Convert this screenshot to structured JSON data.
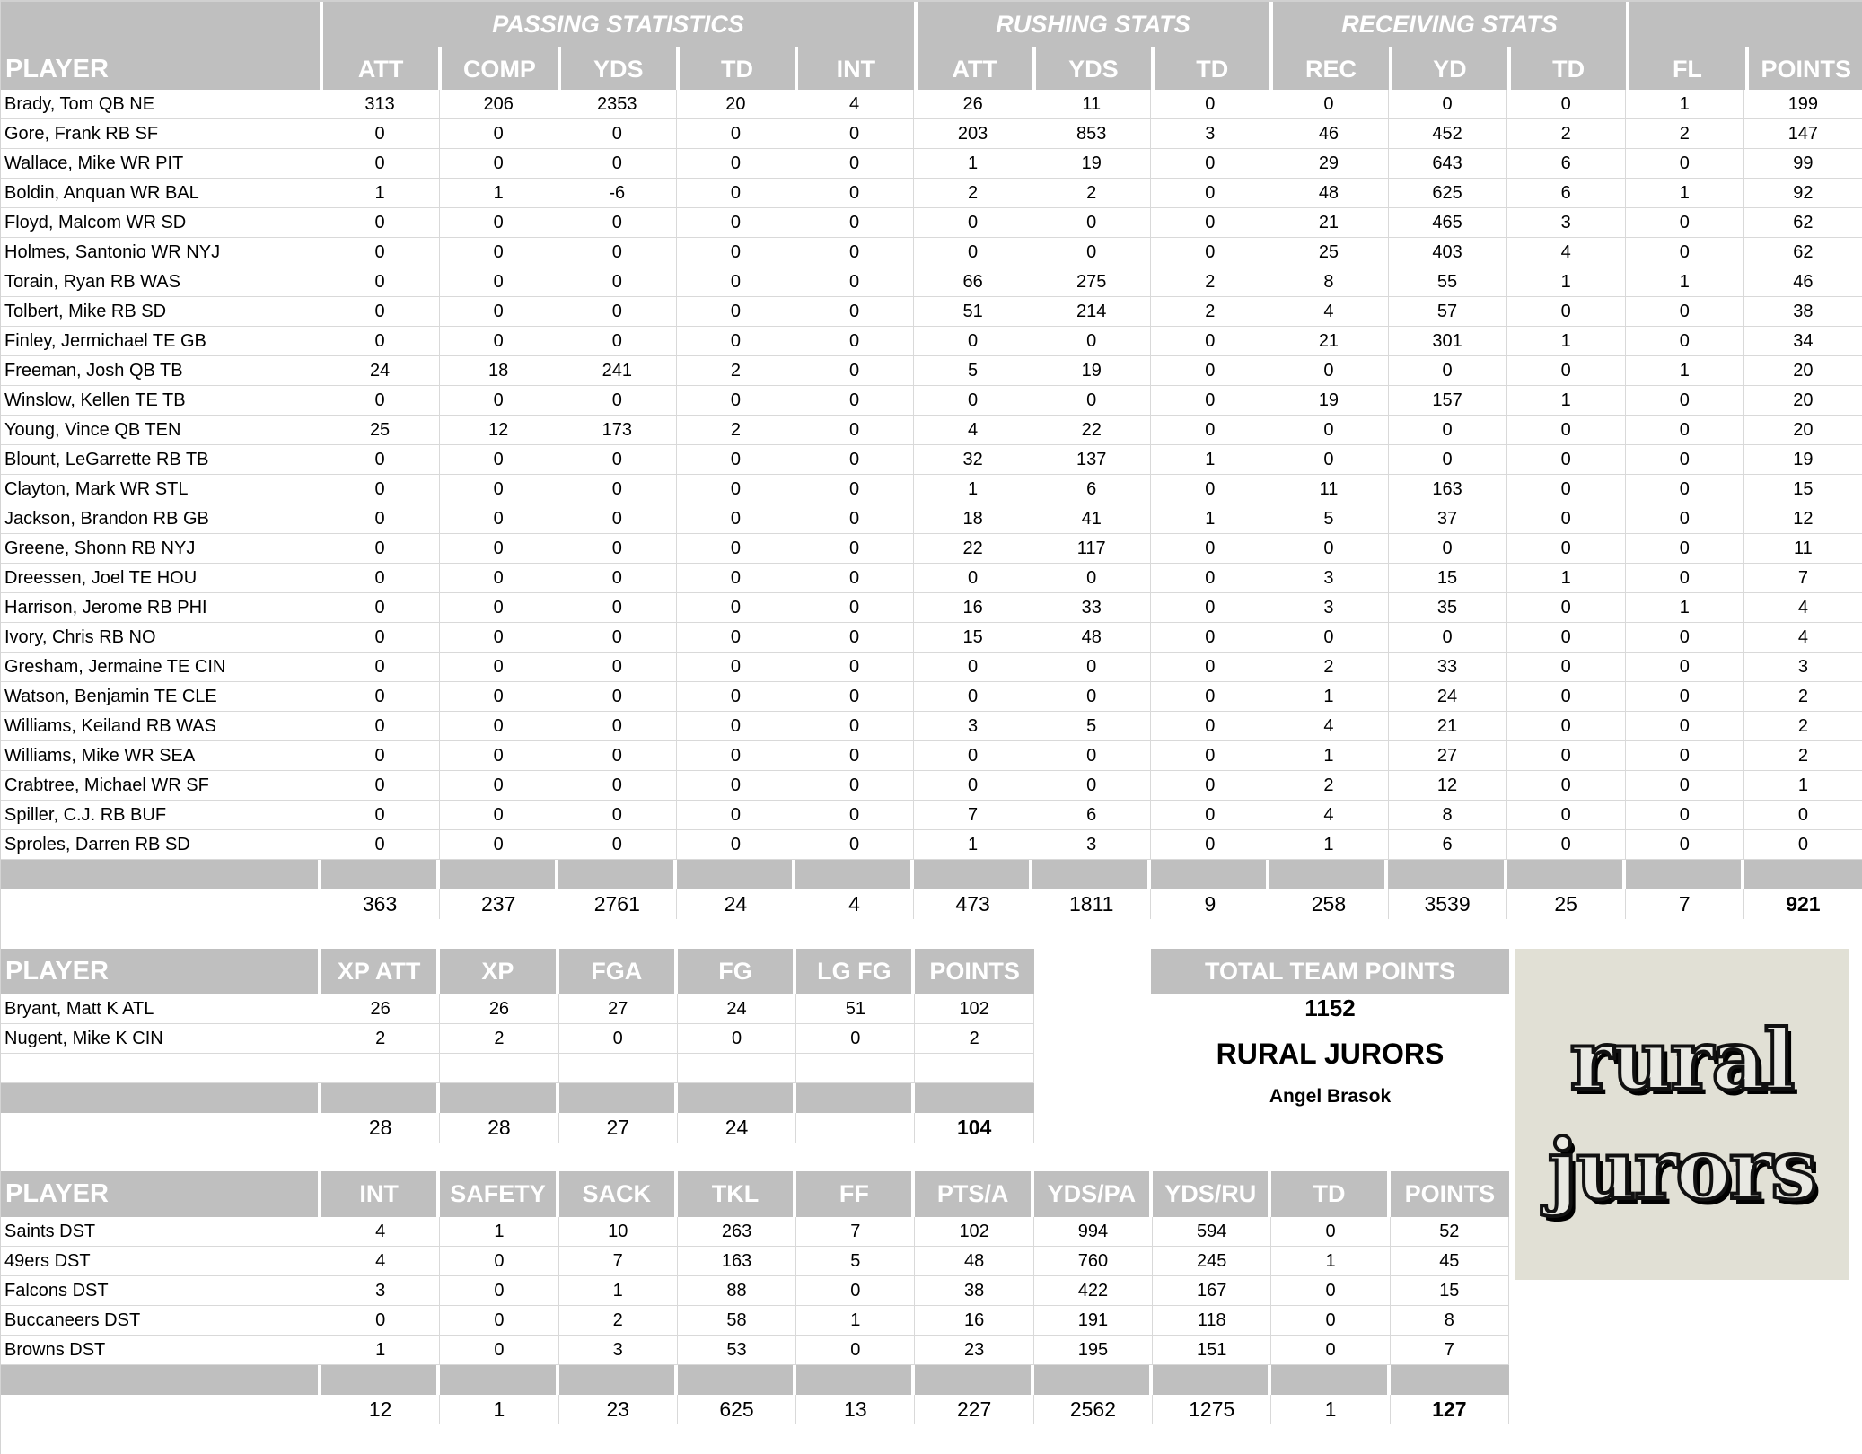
{
  "offense": {
    "group_titles": {
      "passing": "PASSING STATISTICS",
      "rushing": "RUSHING STATS",
      "receiving": "RECEIVING STATS"
    },
    "player_header": "PLAYER",
    "columns": [
      "ATT",
      "COMP",
      "YDS",
      "TD",
      "INT",
      "ATT",
      "YDS",
      "TD",
      "REC",
      "YD",
      "TD",
      "FL",
      "POINTS"
    ],
    "rows": [
      {
        "name": "Brady, Tom QB NE",
        "v": [
          "313",
          "206",
          "2353",
          "20",
          "4",
          "26",
          "11",
          "0",
          "0",
          "0",
          "0",
          "1",
          "199"
        ]
      },
      {
        "name": "Gore, Frank RB SF",
        "v": [
          "0",
          "0",
          "0",
          "0",
          "0",
          "203",
          "853",
          "3",
          "46",
          "452",
          "2",
          "2",
          "147"
        ]
      },
      {
        "name": "Wallace, Mike WR PIT",
        "v": [
          "0",
          "0",
          "0",
          "0",
          "0",
          "1",
          "19",
          "0",
          "29",
          "643",
          "6",
          "0",
          "99"
        ]
      },
      {
        "name": "Boldin, Anquan WR BAL",
        "v": [
          "1",
          "1",
          "-6",
          "0",
          "0",
          "2",
          "2",
          "0",
          "48",
          "625",
          "6",
          "1",
          "92"
        ]
      },
      {
        "name": "Floyd, Malcom WR SD",
        "v": [
          "0",
          "0",
          "0",
          "0",
          "0",
          "0",
          "0",
          "0",
          "21",
          "465",
          "3",
          "0",
          "62"
        ]
      },
      {
        "name": "Holmes, Santonio WR NYJ",
        "v": [
          "0",
          "0",
          "0",
          "0",
          "0",
          "0",
          "0",
          "0",
          "25",
          "403",
          "4",
          "0",
          "62"
        ]
      },
      {
        "name": "Torain, Ryan RB WAS",
        "v": [
          "0",
          "0",
          "0",
          "0",
          "0",
          "66",
          "275",
          "2",
          "8",
          "55",
          "1",
          "1",
          "46"
        ]
      },
      {
        "name": "Tolbert, Mike RB SD",
        "v": [
          "0",
          "0",
          "0",
          "0",
          "0",
          "51",
          "214",
          "2",
          "4",
          "57",
          "0",
          "0",
          "38"
        ]
      },
      {
        "name": "Finley, Jermichael TE GB",
        "v": [
          "0",
          "0",
          "0",
          "0",
          "0",
          "0",
          "0",
          "0",
          "21",
          "301",
          "1",
          "0",
          "34"
        ]
      },
      {
        "name": "Freeman, Josh QB TB",
        "v": [
          "24",
          "18",
          "241",
          "2",
          "0",
          "5",
          "19",
          "0",
          "0",
          "0",
          "0",
          "1",
          "20"
        ]
      },
      {
        "name": "Winslow, Kellen TE TB",
        "v": [
          "0",
          "0",
          "0",
          "0",
          "0",
          "0",
          "0",
          "0",
          "19",
          "157",
          "1",
          "0",
          "20"
        ]
      },
      {
        "name": "Young, Vince QB TEN",
        "v": [
          "25",
          "12",
          "173",
          "2",
          "0",
          "4",
          "22",
          "0",
          "0",
          "0",
          "0",
          "0",
          "20"
        ]
      },
      {
        "name": "Blount, LeGarrette RB TB",
        "v": [
          "0",
          "0",
          "0",
          "0",
          "0",
          "32",
          "137",
          "1",
          "0",
          "0",
          "0",
          "0",
          "19"
        ]
      },
      {
        "name": "Clayton, Mark WR STL",
        "v": [
          "0",
          "0",
          "0",
          "0",
          "0",
          "1",
          "6",
          "0",
          "11",
          "163",
          "0",
          "0",
          "15"
        ]
      },
      {
        "name": "Jackson, Brandon RB GB",
        "v": [
          "0",
          "0",
          "0",
          "0",
          "0",
          "18",
          "41",
          "1",
          "5",
          "37",
          "0",
          "0",
          "12"
        ]
      },
      {
        "name": "Greene, Shonn RB NYJ",
        "v": [
          "0",
          "0",
          "0",
          "0",
          "0",
          "22",
          "117",
          "0",
          "0",
          "0",
          "0",
          "0",
          "11"
        ]
      },
      {
        "name": "Dreessen, Joel TE HOU",
        "v": [
          "0",
          "0",
          "0",
          "0",
          "0",
          "0",
          "0",
          "0",
          "3",
          "15",
          "1",
          "0",
          "7"
        ]
      },
      {
        "name": "Harrison, Jerome RB PHI",
        "v": [
          "0",
          "0",
          "0",
          "0",
          "0",
          "16",
          "33",
          "0",
          "3",
          "35",
          "0",
          "1",
          "4"
        ]
      },
      {
        "name": "Ivory, Chris RB NO",
        "v": [
          "0",
          "0",
          "0",
          "0",
          "0",
          "15",
          "48",
          "0",
          "0",
          "0",
          "0",
          "0",
          "4"
        ]
      },
      {
        "name": "Gresham, Jermaine TE CIN",
        "v": [
          "0",
          "0",
          "0",
          "0",
          "0",
          "0",
          "0",
          "0",
          "2",
          "33",
          "0",
          "0",
          "3"
        ]
      },
      {
        "name": "Watson, Benjamin TE CLE",
        "v": [
          "0",
          "0",
          "0",
          "0",
          "0",
          "0",
          "0",
          "0",
          "1",
          "24",
          "0",
          "0",
          "2"
        ]
      },
      {
        "name": "Williams, Keiland RB WAS",
        "v": [
          "0",
          "0",
          "0",
          "0",
          "0",
          "3",
          "5",
          "0",
          "4",
          "21",
          "0",
          "0",
          "2"
        ]
      },
      {
        "name": "Williams, Mike WR SEA",
        "v": [
          "0",
          "0",
          "0",
          "0",
          "0",
          "0",
          "0",
          "0",
          "1",
          "27",
          "0",
          "0",
          "2"
        ]
      },
      {
        "name": "Crabtree, Michael WR SF",
        "v": [
          "0",
          "0",
          "0",
          "0",
          "0",
          "0",
          "0",
          "0",
          "2",
          "12",
          "0",
          "0",
          "1"
        ]
      },
      {
        "name": "Spiller, C.J. RB BUF",
        "v": [
          "0",
          "0",
          "0",
          "0",
          "0",
          "7",
          "6",
          "0",
          "4",
          "8",
          "0",
          "0",
          "0"
        ]
      },
      {
        "name": "Sproles, Darren RB SD",
        "v": [
          "0",
          "0",
          "0",
          "0",
          "0",
          "1",
          "3",
          "0",
          "1",
          "6",
          "0",
          "0",
          "0"
        ]
      }
    ],
    "totals": [
      "363",
      "237",
      "2761",
      "24",
      "4",
      "473",
      "1811",
      "9",
      "258",
      "3539",
      "25",
      "7",
      "921"
    ]
  },
  "kickers": {
    "player_header": "PLAYER",
    "columns": [
      "XP ATT",
      "XP",
      "FGA",
      "FG",
      "LG FG",
      "POINTS"
    ],
    "rows": [
      {
        "name": "Bryant, Matt K ATL",
        "v": [
          "26",
          "26",
          "27",
          "24",
          "51",
          "102"
        ]
      },
      {
        "name": "Nugent, Mike K CIN",
        "v": [
          "2",
          "2",
          "0",
          "0",
          "0",
          "2"
        ]
      },
      {
        "name": "",
        "v": [
          "",
          "",
          "",
          "",
          "",
          ""
        ]
      }
    ],
    "totals": [
      "28",
      "28",
      "27",
      "24",
      "",
      "104"
    ]
  },
  "defense": {
    "player_header": "PLAYER",
    "columns": [
      "INT",
      "SAFETY",
      "SACK",
      "TKL",
      "FF",
      "PTS/A",
      "YDS/PA",
      "YDS/RU",
      "TD",
      "POINTS"
    ],
    "rows": [
      {
        "name": "Saints DST",
        "v": [
          "4",
          "1",
          "10",
          "263",
          "7",
          "102",
          "994",
          "594",
          "0",
          "52"
        ]
      },
      {
        "name": "49ers DST",
        "v": [
          "4",
          "0",
          "7",
          "163",
          "5",
          "48",
          "760",
          "245",
          "1",
          "45"
        ]
      },
      {
        "name": "Falcons DST",
        "v": [
          "3",
          "0",
          "1",
          "88",
          "0",
          "38",
          "422",
          "167",
          "0",
          "15"
        ]
      },
      {
        "name": "Buccaneers DST",
        "v": [
          "0",
          "0",
          "2",
          "58",
          "1",
          "16",
          "191",
          "118",
          "0",
          "8"
        ]
      },
      {
        "name": "Browns DST",
        "v": [
          "1",
          "0",
          "3",
          "53",
          "0",
          "23",
          "195",
          "151",
          "0",
          "7"
        ]
      }
    ],
    "totals": [
      "12",
      "1",
      "23",
      "625",
      "13",
      "227",
      "2562",
      "1275",
      "1",
      "127"
    ]
  },
  "team": {
    "total_label": "TOTAL TEAM POINTS",
    "total_points": "1152",
    "name": "RURAL JURORS",
    "owner": "Angel Brasok",
    "logo_words": [
      "rural",
      "jurors"
    ],
    "logo_bg": "#e1e0d5"
  },
  "colors": {
    "header_bg": "#bfbfbf",
    "header_text": "#ffffff",
    "grid": "#d9d9d9"
  }
}
